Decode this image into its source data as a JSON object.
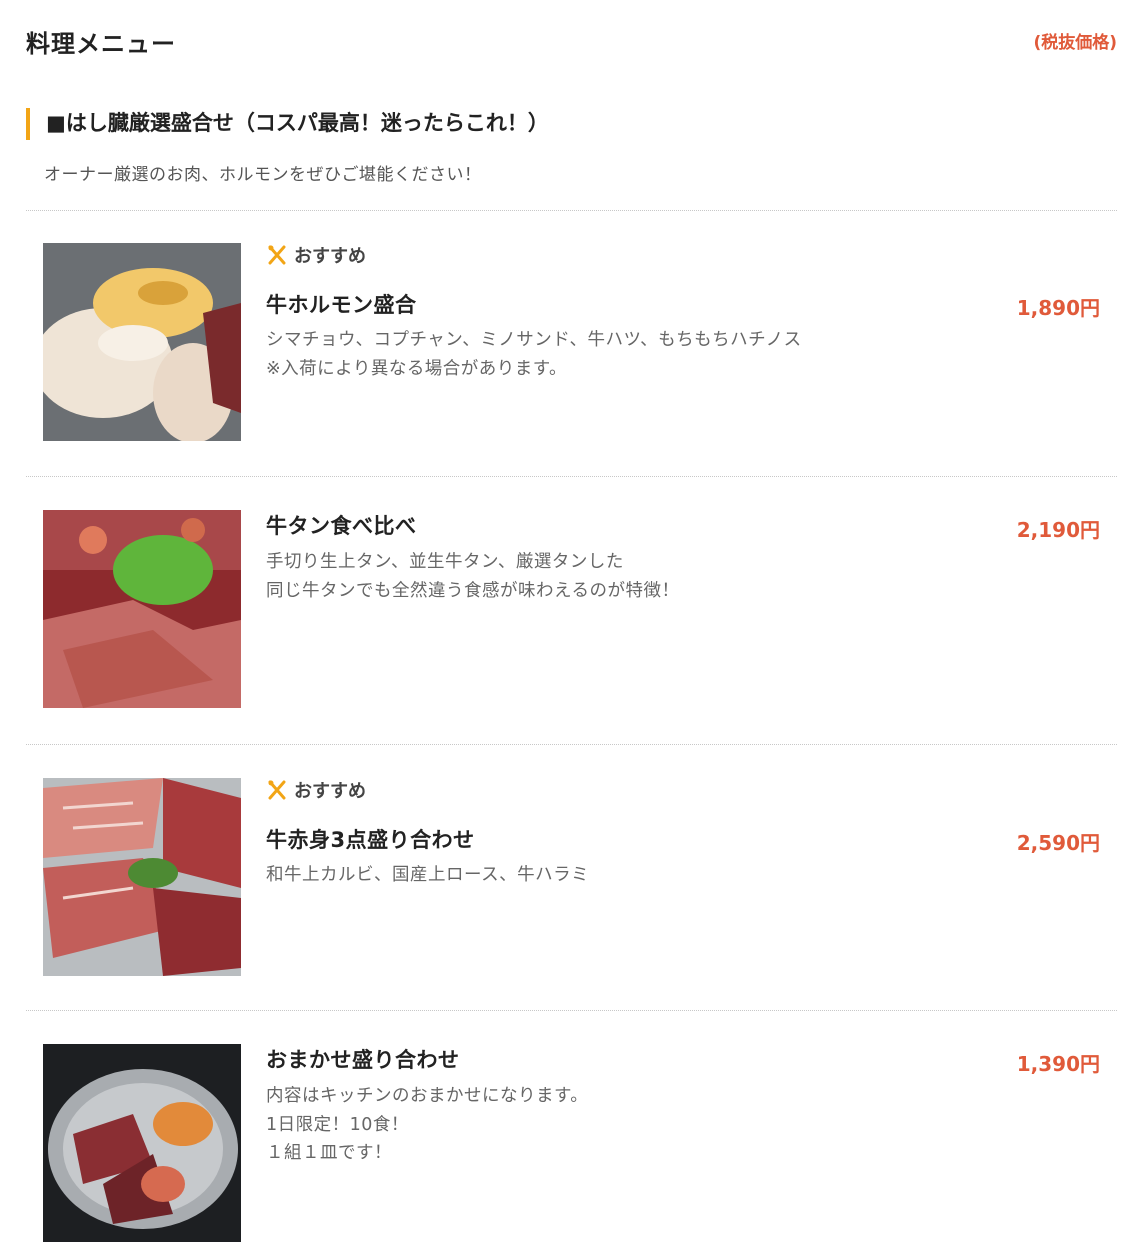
{
  "page": {
    "title": "料理メニュー",
    "tax_note": "(税抜価格)"
  },
  "section": {
    "heading": "■はし臓厳選盛合せ（コスパ最高！迷ったらこれ！）",
    "description": "オーナー厳選のお肉、ホルモンをぜひご堪能ください！"
  },
  "colors": {
    "accent": "#f2a516",
    "price": "#e05a3a"
  },
  "items": [
    {
      "badge": "おすすめ",
      "badge_icon": "fork-knife-icon",
      "name": "牛ホルモン盛合",
      "price": "1,890円",
      "desc_lines": [
        "シマチョウ、コプチャン、ミノサンド、牛ハツ、もちもちハチノス",
        "※入荷により異なる場合があります。"
      ],
      "photo": "beef-offal-platter"
    },
    {
      "badge": "",
      "name": "牛タン食べ比べ",
      "price": "2,190円",
      "desc_lines": [
        "手切り生上タン、並生牛タン、厳選タンした",
        "同じ牛タンでも全然違う食感が味わえるのが特徴！"
      ],
      "photo": "beef-tongue-platter"
    },
    {
      "badge": "おすすめ",
      "badge_icon": "fork-knife-icon",
      "name": "牛赤身3点盛り合わせ",
      "price": "2,590円",
      "desc_lines": [
        "和牛上カルビ、国産上ロース、牛ハラミ"
      ],
      "photo": "red-meat-platter"
    },
    {
      "badge": "",
      "name": "おまかせ盛り合わせ",
      "price": "1,390円",
      "desc_lines": [
        "内容はキッチンのおまかせになります。",
        "1日限定！10食！",
        "１組１皿です！"
      ],
      "photo": "chef-choice-platter"
    }
  ]
}
